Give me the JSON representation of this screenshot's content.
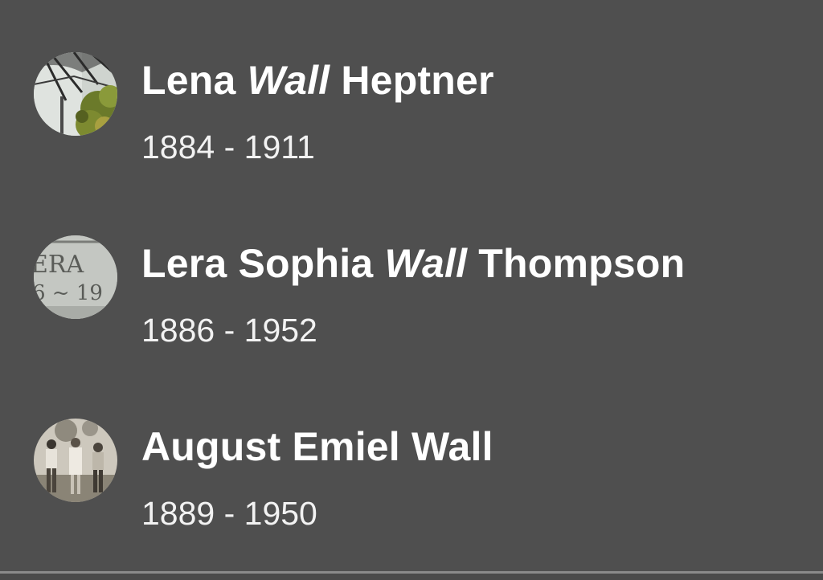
{
  "people": [
    {
      "first": "Lena",
      "maiden": "Wall",
      "last": "Heptner",
      "dates": "1884 - 1911",
      "avatar_icon": "tree-photo-thumbnail"
    },
    {
      "first": "Lera Sophia",
      "maiden": "Wall",
      "last": "Thompson",
      "dates": "1886 - 1952",
      "avatar_icon": "gravestone-photo-thumbnail",
      "avatar_text_top": "ERA",
      "avatar_text_bottom": "6 ~ 19"
    },
    {
      "first": "August Emiel Wall",
      "maiden": "",
      "last": "",
      "dates": "1889 - 1950",
      "avatar_icon": "group-photo-thumbnail"
    }
  ],
  "colors": {
    "background": "#4f4f4f",
    "text": "#ffffff",
    "divider": "#8a8a8a"
  }
}
